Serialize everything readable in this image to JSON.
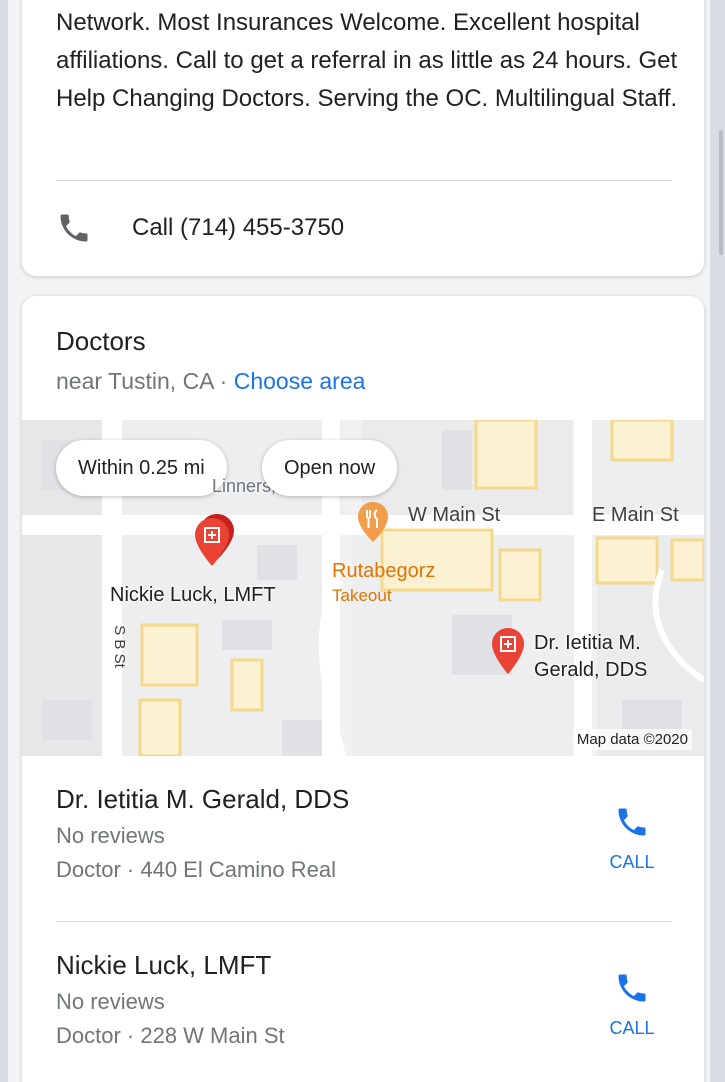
{
  "ad": {
    "description": "Network. Most Insurances Welcome. Excellent hospital affiliations. Call to get a referral in as little as 24 hours. Get Help Changing Doctors. Serving the OC. Multilingual Staff.",
    "call_label": "Call (714) 455-3750"
  },
  "section": {
    "title": "Doctors",
    "location": "near Tustin, CA · ",
    "choose_area": "Choose area"
  },
  "map": {
    "chips": [
      "Within 0.25 mi",
      "Open now"
    ],
    "partial_label": "Linners, PSYC",
    "streets": [
      "W Main St",
      "E Main St",
      "S B St"
    ],
    "restaurant": {
      "name": "Rutabegorz",
      "sub": "Takeout"
    },
    "pin_labels": [
      "Nickie Luck, LMFT",
      "Dr. Ietitia M. Gerald, DDS"
    ],
    "attribution": "Map data ©2020"
  },
  "results": [
    {
      "name": "Dr. Ietitia M. Gerald, DDS",
      "reviews": "No reviews",
      "meta": "Doctor · 440 El Camino Real",
      "call": "CALL"
    },
    {
      "name": "Nickie Luck, LMFT",
      "reviews": "No reviews",
      "meta": "Doctor · 228 W Main St",
      "call": "CALL"
    }
  ],
  "colors": {
    "link": "#1a73e8",
    "pin": "#ea4335",
    "restaurant": "#f29d4b"
  }
}
